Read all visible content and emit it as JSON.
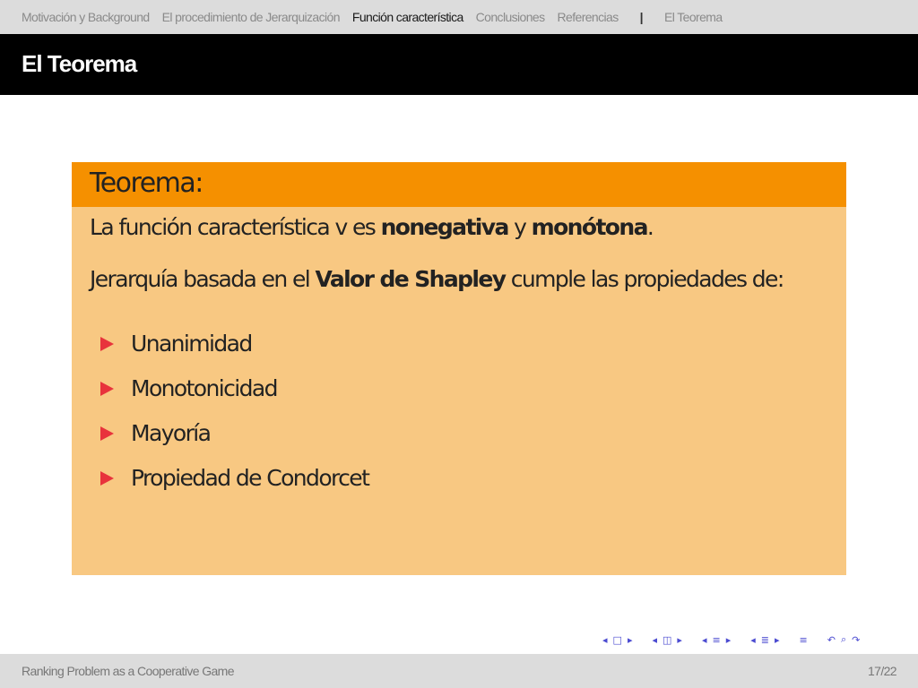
{
  "nav": {
    "sections": [
      "Motivación y Background",
      "El procedimiento de Jerarquización",
      "Función característica",
      "Conclusiones",
      "Referencias"
    ],
    "active_index": 2,
    "separator": "|",
    "subsection": "El Teorema"
  },
  "frame": {
    "title": "El Teorema"
  },
  "block": {
    "title": "Teorema:",
    "line1": {
      "pre": "La función característica v es ",
      "bold1": "nonegativa",
      "mid": " y ",
      "bold2": "monótona",
      "post": "."
    },
    "line2": {
      "pre": "Jerarquía basada en el ",
      "bold": "Valor de Shapley",
      "post": " cumple las propiedades de:"
    },
    "items": [
      "Unanimidad",
      "Monotonicidad",
      "Mayoría",
      "Propiedad de Condorcet"
    ],
    "colors": {
      "header": "#f59000",
      "body": "#f8c882",
      "bullet": "#e8333c"
    }
  },
  "navigation_symbols": {
    "icons": [
      "prev-frame-icon",
      "frame-icon",
      "next-frame-icon",
      "prev-subsection-icon",
      "subsection-icon",
      "next-subsection-icon",
      "prev-section-icon",
      "section-icon",
      "next-section-icon",
      "prev-doc-icon",
      "doc-icon",
      "next-doc-icon",
      "align-icon",
      "back-icon",
      "search-icon",
      "forward-icon"
    ]
  },
  "footer": {
    "title": "Ranking Problem as a Cooperative Game",
    "page": "17/22"
  }
}
